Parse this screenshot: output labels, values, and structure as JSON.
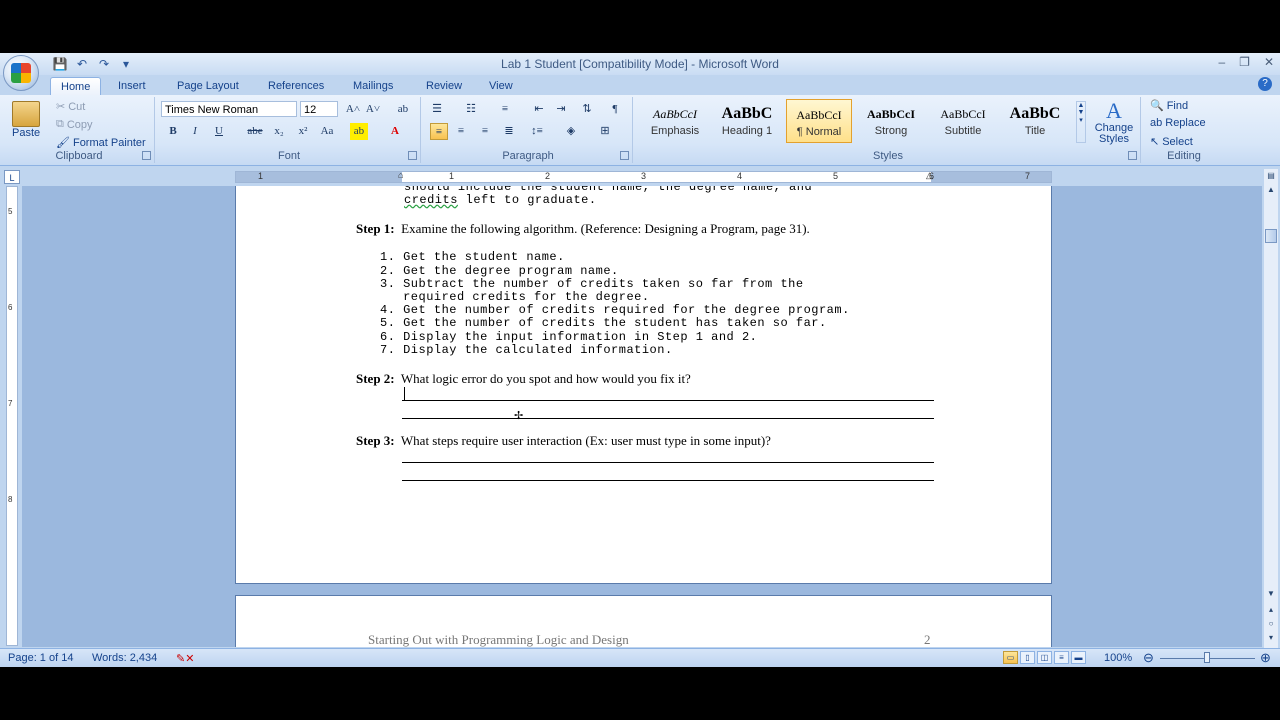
{
  "window": {
    "title": "Lab 1 Student [Compatibility Mode] - Microsoft Word",
    "controls": [
      "–",
      "❐",
      "✕"
    ]
  },
  "qat": {
    "save": "💾",
    "undo": "↶",
    "redo": "↷",
    "more": "▾"
  },
  "tabs": [
    "Home",
    "Insert",
    "Page Layout",
    "References",
    "Mailings",
    "Review",
    "View"
  ],
  "ribbon": {
    "clipboard": {
      "label": "Clipboard",
      "paste": "Paste",
      "cut": "Cut",
      "copy": "Copy",
      "format_painter": "Format Painter"
    },
    "font": {
      "label": "Font",
      "name": "Times New Roman",
      "size": "12"
    },
    "paragraph": {
      "label": "Paragraph"
    },
    "styles": {
      "label": "Styles",
      "items": [
        {
          "sample": "AaBbCcI",
          "name": "Emphasis"
        },
        {
          "sample": "AaBbC",
          "name": "Heading 1"
        },
        {
          "sample": "AaBbCcI",
          "name": "¶ Normal"
        },
        {
          "sample": "AaBbCcI",
          "name": "Strong"
        },
        {
          "sample": "AaBbCcI",
          "name": "Subtitle"
        },
        {
          "sample": "AaBbC",
          "name": "Title"
        }
      ],
      "change_styles": "Change Styles"
    },
    "editing": {
      "label": "Editing",
      "find": "Find",
      "replace": "Replace",
      "select": "Select"
    }
  },
  "document": {
    "intro_lines": [
      "should include the student name, the degree name, and",
      "left to graduate."
    ],
    "intro_spell_word": "credits",
    "step1": {
      "label": "Step 1:",
      "text": "Examine the following algorithm.  (Reference: Designing a Program, page 31)."
    },
    "algorithm": [
      "1. Get the student name.",
      "2. Get the degree program name.",
      "3. Subtract the number of credits taken so far from the",
      "   required credits for the degree.",
      "4. Get the number of credits required for the degree program.",
      "5. Get the number of credits the student has taken so far.",
      "6. Display the input information in Step 1 and 2.",
      "7. Display the calculated information."
    ],
    "step2": {
      "label": "Step 2:",
      "text": "What logic error do you spot and how would you fix it?"
    },
    "step3": {
      "label": "Step 3:",
      "text": "What steps require user interaction (Ex: user must type in some input)?"
    },
    "footer_left": "Starting Out with Programming  Logic and Design",
    "footer_page": "2"
  },
  "ruler": {
    "h_numbers": [
      "1",
      "1",
      "2",
      "3",
      "4",
      "5",
      "6",
      "7"
    ],
    "v_numbers": [
      "5",
      "6",
      "7",
      "8"
    ]
  },
  "status": {
    "page": "Page: 1 of 14",
    "words": "Words: 2,434",
    "zoom": "100%"
  }
}
